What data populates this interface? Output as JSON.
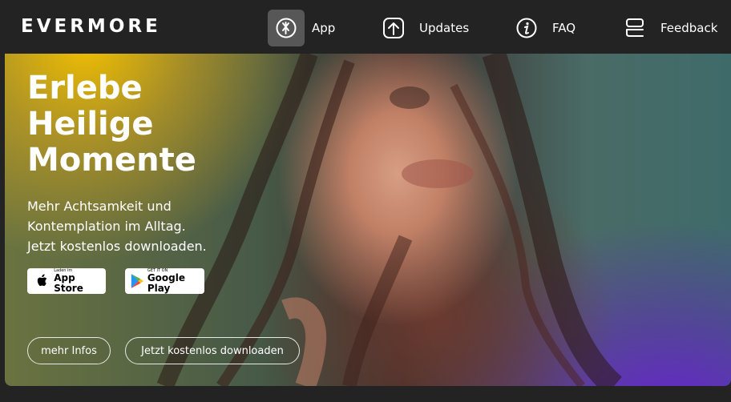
{
  "brand": {
    "logo": "EVERMORE"
  },
  "nav": {
    "items": [
      {
        "label": "App",
        "icon": "app-logo-icon",
        "active": true
      },
      {
        "label": "Updates",
        "icon": "arrow-up-icon"
      },
      {
        "label": "FAQ",
        "icon": "info-icon"
      },
      {
        "label": "Feedback",
        "icon": "feedback-icon"
      }
    ]
  },
  "hero": {
    "title_line1": "Erlebe",
    "title_line2": "Heilige",
    "title_line3": "Momente",
    "sub_line1": "Mehr Achtsamkeit und",
    "sub_line2": "Kontemplation im Alltag.",
    "sub_line3": "Jetzt kostenlos downloaden.",
    "appstore_small": "Laden im",
    "appstore_big": "App Store",
    "googleplay_small": "GET IT ON",
    "googleplay_big": "Google Play",
    "btn_more": "mehr Infos",
    "btn_download": "Jetzt kostenlos downloaden"
  },
  "colors": {
    "nav_bg": "#232323",
    "active_icon_bg": "#575757",
    "accent_yellow": "#f3c000",
    "accent_purple": "#6a1fd6"
  }
}
